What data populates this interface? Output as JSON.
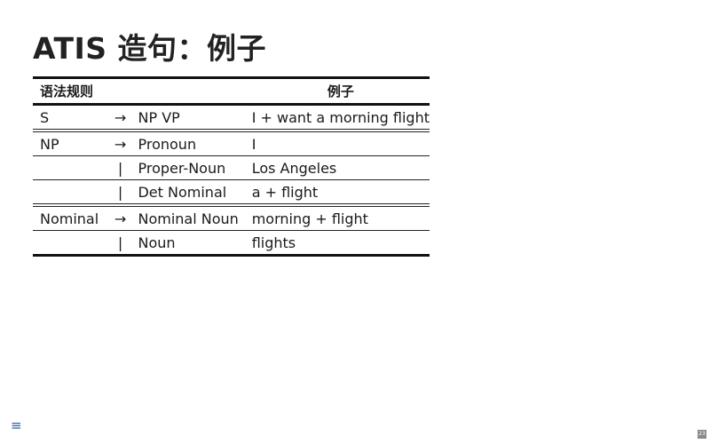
{
  "title": "ATIS 造句：例子",
  "table": {
    "headers": {
      "rule": "语法规则",
      "example": "例子"
    },
    "rows": [
      {
        "lhs": "S",
        "arrow": "→",
        "rhs": "NP VP",
        "example": "I + want a morning flight"
      },
      {
        "lhs": "NP",
        "arrow": "→",
        "rhs": "Pronoun",
        "example": "I"
      },
      {
        "lhs": "",
        "arrow": "|",
        "rhs": "Proper-Noun",
        "example": "Los Angeles"
      },
      {
        "lhs": "",
        "arrow": "|",
        "rhs": "Det Nominal",
        "example": "a + flight"
      },
      {
        "lhs": "Nominal",
        "arrow": "→",
        "rhs": "Nominal Noun",
        "example": "morning + flight"
      },
      {
        "lhs": "",
        "arrow": "|",
        "rhs": "Noun",
        "example": "flights"
      }
    ]
  },
  "footer": {
    "menu_icon": "menu-icon",
    "page_number": "23"
  }
}
